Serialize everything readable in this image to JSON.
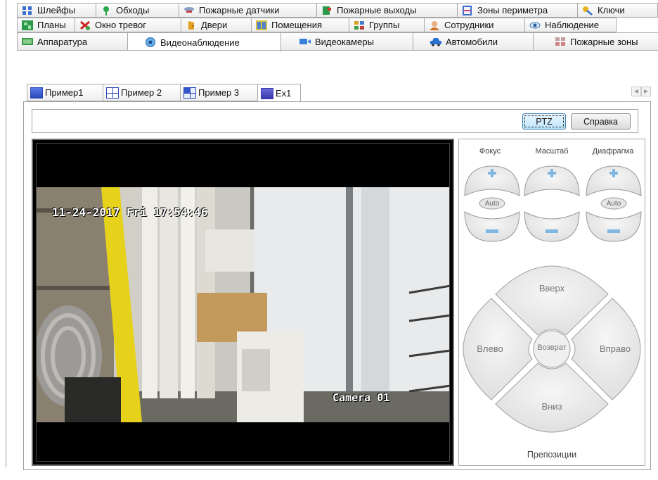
{
  "tabs_row1": [
    {
      "label": "Шлейфы",
      "icon": "loops-icon"
    },
    {
      "label": "Обходы",
      "icon": "patrol-icon"
    },
    {
      "label": "Пожарные датчики",
      "icon": "fire-sensor-icon"
    },
    {
      "label": "Пожарные выходы",
      "icon": "fire-exit-icon"
    },
    {
      "label": "Зоны периметра",
      "icon": "perimeter-icon"
    },
    {
      "label": "Ключи",
      "icon": "key-icon"
    }
  ],
  "tabs_row2": [
    {
      "label": "Планы",
      "icon": "plans-icon"
    },
    {
      "label": "Окно тревог",
      "icon": "alarm-icon"
    },
    {
      "label": "Двери",
      "icon": "door-icon"
    },
    {
      "label": "Помещения",
      "icon": "rooms-icon"
    },
    {
      "label": "Группы",
      "icon": "groups-icon"
    },
    {
      "label": "Сотрудники",
      "icon": "employee-icon"
    },
    {
      "label": "Наблюдение",
      "icon": "eye-icon"
    }
  ],
  "tabs_row3": [
    {
      "label": "Аппаратура",
      "icon": "hardware-icon",
      "active": false
    },
    {
      "label": "Видеонаблюдение",
      "icon": "video-surveillance-icon",
      "active": true
    },
    {
      "label": "Видеокамеры",
      "icon": "camera-icon",
      "active": false
    },
    {
      "label": "Автомобили",
      "icon": "car-icon",
      "active": false
    },
    {
      "label": "Пожарные зоны",
      "icon": "fire-zone-icon",
      "active": false
    }
  ],
  "layout_tabs": [
    {
      "label": "Пример1",
      "icon": "grid-icon",
      "style": "solid"
    },
    {
      "label": "Пример 2",
      "icon": "grid-icon",
      "style": "grid"
    },
    {
      "label": "Пример 3",
      "icon": "grid-icon",
      "style": "mixed"
    },
    {
      "label": "Ex1",
      "icon": "grid-icon",
      "style": "purple",
      "active": true
    }
  ],
  "toolbar": {
    "ptz_label": "PTZ",
    "help_label": "Справка"
  },
  "video": {
    "timestamp": "11-24-2017 Fri 17:54:46",
    "camera_name": "Camera 01"
  },
  "ptz": {
    "focus_label": "Фокус",
    "zoom_label": "Масштаб",
    "iris_label": "Диафрагма",
    "auto_label": "Auto",
    "up_label": "Вверх",
    "down_label": "Вниз",
    "left_label": "Влево",
    "right_label": "Вправо",
    "home_label": "Возврат",
    "presets_label": "Препозиции"
  },
  "colors": {
    "accent": "#3c7fb1",
    "plus_minus": "#7fb6e0",
    "pad_fill": "#e8e8e8"
  }
}
